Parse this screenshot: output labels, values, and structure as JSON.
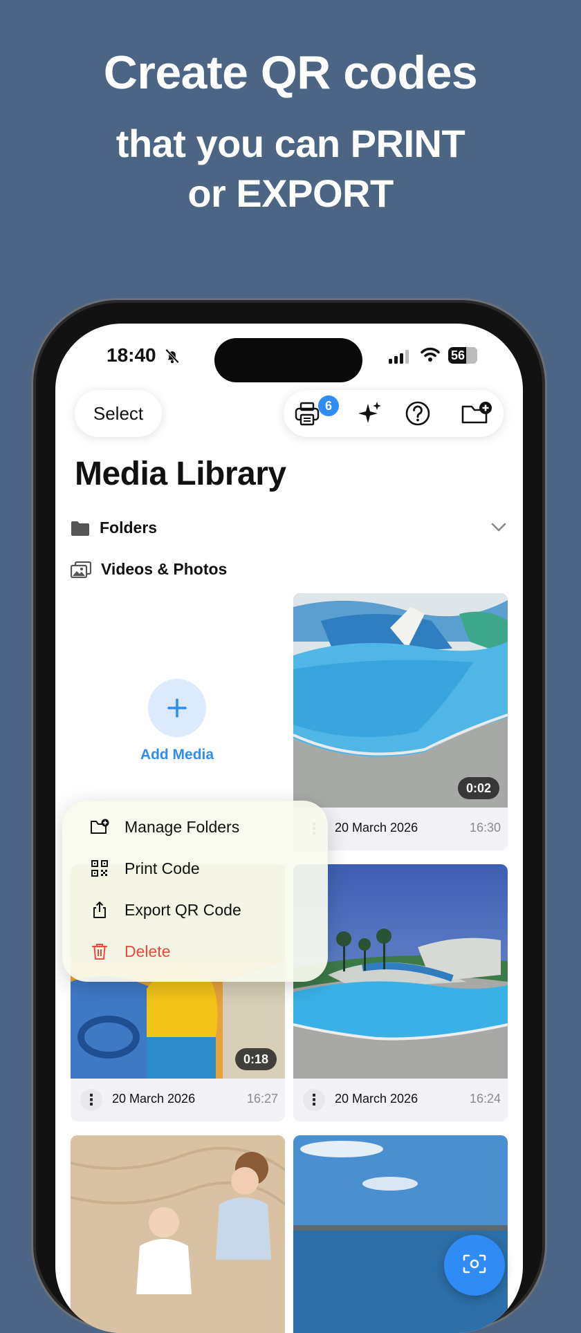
{
  "headline": {
    "line1": "Create QR codes",
    "line2": "that you can PRINT",
    "line3": "or EXPORT"
  },
  "status_bar": {
    "time": "18:40",
    "battery": "56"
  },
  "toolbar": {
    "select_label": "Select",
    "print_badge": "6"
  },
  "title": "Media Library",
  "sections": {
    "folders": "Folders",
    "videos_photos": "Videos & Photos"
  },
  "add_media": {
    "label": "Add Media"
  },
  "media": [
    {
      "duration": "0:02",
      "date": "20 March 2026",
      "time": "16:30"
    },
    {
      "duration": "0:18",
      "date": "20 March 2026",
      "time": "16:27"
    },
    {
      "duration": "",
      "date": "20 March 2026",
      "time": "16:24"
    }
  ],
  "context_menu": {
    "manage_folders": "Manage Folders",
    "print_code": "Print Code",
    "export_qr": "Export QR Code",
    "delete": "Delete"
  },
  "colors": {
    "accent": "#2f8cf5",
    "destructive": "#e94b3c",
    "background": "#4c6584"
  }
}
